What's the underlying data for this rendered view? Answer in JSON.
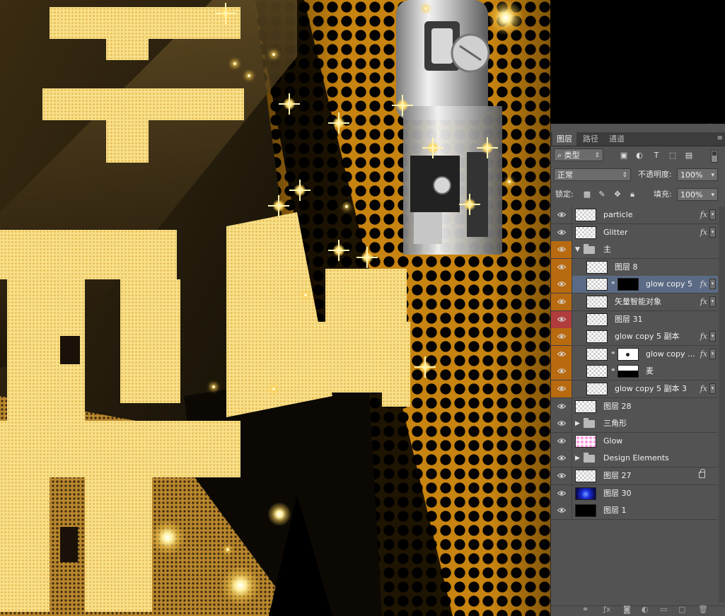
{
  "canvas": {
    "big_chars": [
      "字",
      "战",
      "日"
    ]
  },
  "panel": {
    "tabs": [
      {
        "label": "图层",
        "active": true
      },
      {
        "label": "路径",
        "active": false
      },
      {
        "label": "通道",
        "active": false
      }
    ],
    "filter_kind": "类型",
    "blend_mode": "正常",
    "opacity_label": "不透明度:",
    "opacity_value": "100%",
    "lock_label": "锁定:",
    "fill_label": "填充:",
    "fill_value": "100%",
    "layers": [
      {
        "name": "particle",
        "fx": "fx",
        "eye": "none",
        "thumb": "checker"
      },
      {
        "name": "Glitter",
        "fx": "fx",
        "eye": "none",
        "thumb": "checker"
      },
      {
        "name": "主",
        "group": true,
        "expanded": true,
        "eye": "orange"
      },
      {
        "name": "图层 8",
        "eye": "orange",
        "thumb": "checker"
      },
      {
        "name": "glow copy 5",
        "fx": "fx",
        "eye": "orange",
        "thumb": "checker",
        "mask": "black",
        "selected": true
      },
      {
        "name": "矢量智能对象",
        "fx": "fx",
        "eye": "orange",
        "thumb": "checker"
      },
      {
        "name": "图层 31",
        "eye": "red",
        "thumb": "checker"
      },
      {
        "name": "glow copy 5 副本",
        "fx": "fx",
        "eye": "orange",
        "thumb": "checker"
      },
      {
        "name": "glow copy ...",
        "fx": "fx",
        "eye": "orange",
        "thumb": "checker",
        "mask": "dot"
      },
      {
        "name": "麦",
        "eye": "orange",
        "thumb": "checker",
        "mask": "half"
      },
      {
        "name": "glow copy 5 副本 3",
        "fx": "fx",
        "eye": "orange",
        "thumb": "checker"
      },
      {
        "name": "图层 28",
        "eye": "none",
        "thumb": "checker"
      },
      {
        "name": "三角形",
        "group": true,
        "expanded": false,
        "eye": "none"
      },
      {
        "name": "Glow",
        "eye": "none",
        "thumb": "pink"
      },
      {
        "name": "Design Elements",
        "group": true,
        "expanded": false,
        "eye": "none"
      },
      {
        "name": "图层 27",
        "eye": "none",
        "thumb": "checker",
        "locked": true
      },
      {
        "name": "图层 30",
        "eye": "none",
        "thumb": "blue"
      },
      {
        "name": "图层 1",
        "eye": "none",
        "thumb": "black"
      }
    ],
    "bottom_icons": [
      "link-icon",
      "fx-icon",
      "mask-icon",
      "adjustment-icon",
      "folder-icon",
      "new-layer-icon",
      "trash-icon"
    ]
  }
}
